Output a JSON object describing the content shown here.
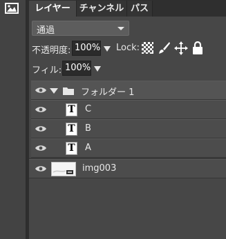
{
  "tabs": [
    "レイヤー",
    "チャンネル",
    "パス"
  ],
  "blend_mode": "通過",
  "opacity": {
    "label": "不透明度:",
    "value": "100%"
  },
  "lock": {
    "label": "Lock:"
  },
  "fill": {
    "label": "フィル:",
    "value": "100%"
  },
  "layers": [
    {
      "name": "フォルダー 1",
      "type": "folder"
    },
    {
      "name": "C",
      "type": "text"
    },
    {
      "name": "B",
      "type": "text"
    },
    {
      "name": "A",
      "type": "text"
    },
    {
      "name": "img003",
      "type": "image"
    }
  ],
  "text_layer_glyph": "T",
  "icons": [
    "image-icon",
    "eye-icon",
    "folder-icon",
    "chevron-down-icon",
    "checkerboard-lock-icon",
    "brush-lock-icon",
    "move-lock-icon",
    "padlock-icon"
  ]
}
